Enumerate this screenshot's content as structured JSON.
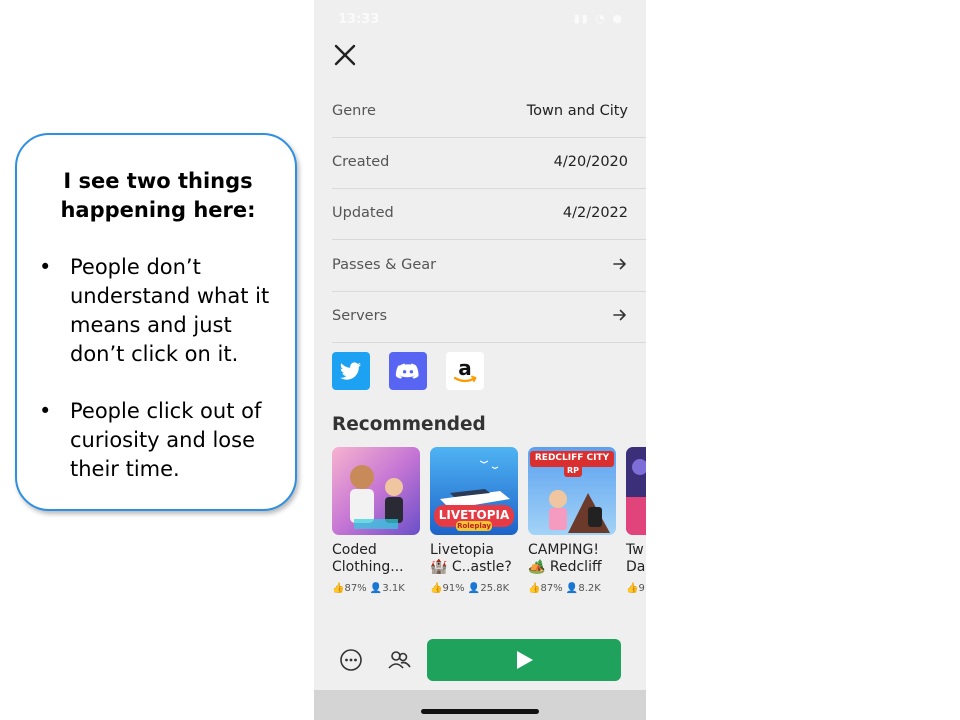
{
  "slide": {
    "title": "I see two things happening here:",
    "bullets": [
      "People don’t understand what it means and just don’t click on it.",
      "People click out of curiosity and lose their time."
    ],
    "bullet_char": "•",
    "accent_color": "#2f8fe0"
  },
  "phone": {
    "status_time": "13:33",
    "status_icons": "▮▮ ◔ ●",
    "close_icon": "close-icon",
    "details": [
      {
        "label": "Genre",
        "value": "Town and City"
      },
      {
        "label": "Created",
        "value": "4/20/2020"
      },
      {
        "label": "Updated",
        "value": "4/2/2022"
      },
      {
        "label": "Passes & Gear",
        "value": ""
      },
      {
        "label": "Servers",
        "value": ""
      }
    ],
    "social": [
      "twitter-icon",
      "discord-icon",
      "amazon-icon"
    ],
    "recommended_title": "Recommended",
    "games": [
      {
        "name": "Coded\nClothing...",
        "rating": "87%",
        "players": "3.1K"
      },
      {
        "name": "Livetopia\n🏰 C..astle?",
        "rating": "91%",
        "players": "25.8K",
        "badge": "LIVETOPIA",
        "badge_sub": "Roleplay"
      },
      {
        "name": "CAMPING!\n🏕️ Redcliff",
        "rating": "87%",
        "players": "8.2K",
        "badge": "REDCLIFF CITY",
        "badge_sub": "RP"
      },
      {
        "name": "Tw\nDa",
        "rating": "9",
        "players": ""
      }
    ],
    "play_color": "#1fa25c"
  }
}
